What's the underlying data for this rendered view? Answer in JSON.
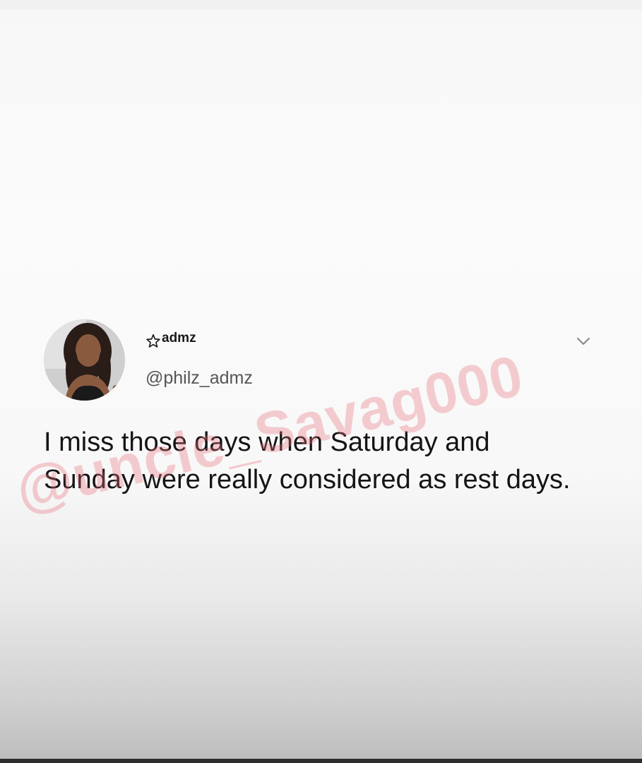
{
  "tweet": {
    "display_name": "admz",
    "display_name_prefix_icon": "star-outline-icon",
    "username": "@philz_admz",
    "text": "I miss those days when Saturday and Sunday were really considered as rest days.",
    "menu_icon": "chevron-down-icon"
  },
  "watermark": {
    "text": "@uncle_Savag000"
  },
  "colors": {
    "watermark": "#e86e78",
    "text": "#151515",
    "username": "#555555"
  }
}
